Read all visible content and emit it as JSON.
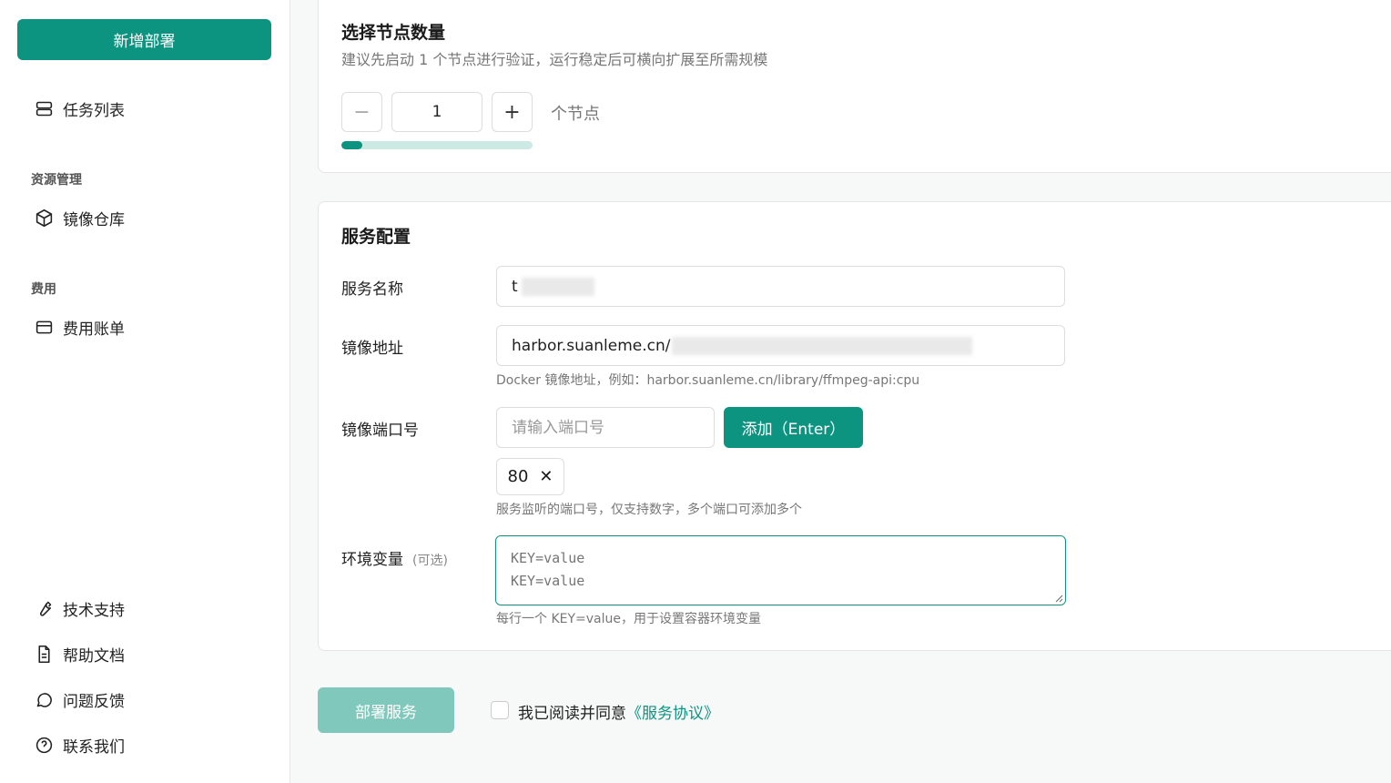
{
  "sidebar": {
    "new_button": "新增部署",
    "task_list": "任务列表",
    "group_resources": "资源管理",
    "image_repo": "镜像仓库",
    "group_billing": "费用",
    "billing": "费用账单",
    "tech_support": "技术支持",
    "help_docs": "帮助文档",
    "feedback": "问题反馈",
    "contact": "联系我们"
  },
  "nodes": {
    "title": "选择节点数量",
    "subtitle": "建议先启动 1 个节点进行验证，运行稳定后可横向扩展至所需规模",
    "minus": "−",
    "plus": "+",
    "count": "1",
    "unit": "个节点",
    "progress_fraction": 0.11
  },
  "service": {
    "title": "服务配置",
    "name_label": "服务名称",
    "name_value": "t",
    "image_label": "镜像地址",
    "image_value": "harbor.suanleme.cn/",
    "image_hint": "Docker 镜像地址，例如：harbor.suanleme.cn/library/ffmpeg-api:cpu",
    "port_label": "镜像端口号",
    "port_placeholder": "请输入端口号",
    "add_button": "添加（Enter）",
    "port_tag": "80",
    "port_tag_remove": "✕",
    "port_hint": "服务监听的端口号，仅支持数字，多个端口可添加多个",
    "env_label": "环境变量",
    "env_optional": "(可选)",
    "env_placeholder": "KEY=value\nKEY=value",
    "env_hint": "每行一个 KEY=value，用于设置容器环境变量"
  },
  "footer": {
    "deploy_button": "部署服务",
    "agree_text": "我已阅读并同意",
    "agree_link": "《服务协议》"
  },
  "colors": {
    "accent": "#0d9480",
    "accent_disabled": "#80c8bc"
  }
}
